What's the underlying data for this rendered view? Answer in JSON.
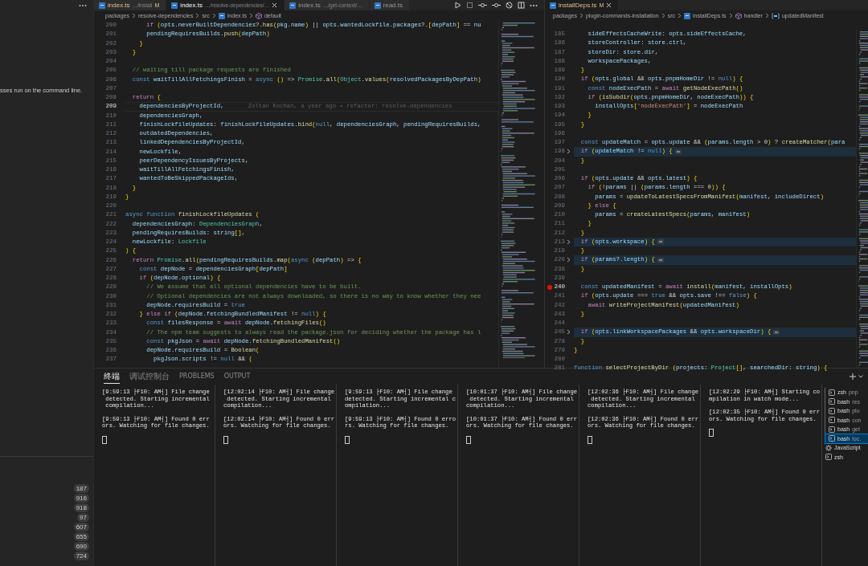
{
  "sidebar": {
    "description": "sses run on the command line.",
    "counts": [
      "187",
      "916",
      "918",
      "97",
      "607",
      "655",
      "690",
      "724"
    ]
  },
  "editor_groups": [
    {
      "tabs": [
        {
          "name": "index.ts",
          "path": "…/install",
          "badge": "M",
          "modified": true,
          "selected": false
        },
        {
          "name": "index.ts",
          "path": "…/resolve-dependencies/…",
          "modified": false,
          "selected": true
        },
        {
          "name": "index.ts",
          "path": "…/get-context/…",
          "modified": false,
          "selected": false
        },
        {
          "name": "read.ts",
          "modified": false,
          "selected": false
        }
      ],
      "breadcrumb": [
        {
          "label": "packages",
          "kind": "folder"
        },
        {
          "label": "resolve-dependencies",
          "kind": "folder"
        },
        {
          "label": "src",
          "kind": "folder"
        },
        {
          "label": "index.ts",
          "kind": "file"
        },
        {
          "label": "default",
          "kind": "module"
        }
      ],
      "lines": [
        {
          "n": "200",
          "kind": "code",
          "text": "      if (opts.neverBuiltDependencies?.has(pkg.name) || opts.wantedLockfile.packages?.[depPath] == nu"
        },
        {
          "n": "201",
          "kind": "code",
          "text": "      pendingRequiresBuilds.push(depPath)"
        },
        {
          "n": "202",
          "kind": "code",
          "text": "    }"
        },
        {
          "n": "203",
          "kind": "code",
          "text": "  }"
        },
        {
          "n": "204",
          "kind": "code"
        },
        {
          "n": "205",
          "kind": "code",
          "text": "  // waiting till package requests are finished"
        },
        {
          "n": "206",
          "kind": "code",
          "text": "  const waitTillAllFetchingsFinish = async () => Promise.all(Object.values(resolvedPackagesByDepPath)"
        },
        {
          "n": "207",
          "kind": "code"
        },
        {
          "n": "208",
          "kind": "code",
          "text": "  return {"
        },
        {
          "n": "209",
          "kind": "current",
          "text": "    dependenciesByProjectId,",
          "blame": "Zoltan Kochan, a year ago • refactor: resolve-dependencies"
        },
        {
          "n": "210",
          "kind": "code",
          "text": "    dependenciesGraph,"
        },
        {
          "n": "211",
          "kind": "code",
          "text": "    finishLockfileUpdates: finishLockfileUpdates.bind(null, dependenciesGraph, pendingRequiresBuilds,"
        },
        {
          "n": "212",
          "kind": "code",
          "text": "    outdatedDependencies,"
        },
        {
          "n": "213",
          "kind": "code",
          "text": "    linkedDependenciesByProjectId,"
        },
        {
          "n": "214",
          "kind": "code",
          "text": "    newLockfile,"
        },
        {
          "n": "215",
          "kind": "code",
          "text": "    peerDependencyIssuesByProjects,"
        },
        {
          "n": "216",
          "kind": "code",
          "text": "    waitTillAllFetchingsFinish,"
        },
        {
          "n": "217",
          "kind": "code",
          "text": "    wantedToBeSkippedPackageIds,"
        },
        {
          "n": "218",
          "kind": "code",
          "text": "  }"
        },
        {
          "n": "219",
          "kind": "code",
          "text": "}"
        },
        {
          "n": "220",
          "kind": "code"
        },
        {
          "n": "221",
          "kind": "code",
          "text": "async function finishLockfileUpdates ("
        },
        {
          "n": "222",
          "kind": "code",
          "text": "  dependenciesGraph: DependenciesGraph,"
        },
        {
          "n": "223",
          "kind": "code",
          "text": "  pendingRequiresBuilds: string[],"
        },
        {
          "n": "224",
          "kind": "code",
          "text": "  newLockfile: Lockfile"
        },
        {
          "n": "225",
          "kind": "code",
          "text": ") {"
        },
        {
          "n": "226",
          "kind": "code",
          "text": "  return Promise.all(pendingRequiresBuilds.map(async (depPath) => {"
        },
        {
          "n": "227",
          "kind": "code",
          "text": "    const depNode = dependenciesGraph[depPath]"
        },
        {
          "n": "228",
          "kind": "code",
          "text": "    if (depNode.optional) {"
        },
        {
          "n": "229",
          "kind": "code",
          "text": "      // We assume that all optional dependencies have to be built."
        },
        {
          "n": "230",
          "kind": "code",
          "text": "      // Optional dependencies are not always downloaded, so there is no way to know whether they nee"
        },
        {
          "n": "231",
          "kind": "code",
          "text": "      depNode.requiresBuild = true"
        },
        {
          "n": "232",
          "kind": "code",
          "text": "    } else if (depNode.fetchingBundledManifest != null) {"
        },
        {
          "n": "233",
          "kind": "code",
          "text": "      const filesResponse = await depNode.fetchingFiles()"
        },
        {
          "n": "234",
          "kind": "code",
          "text": "      // The npm team suggests to always read the package.json for deciding whether the package has l"
        },
        {
          "n": "235",
          "kind": "code",
          "text": "      const pkgJson = await depNode.fetchingBundledManifest()"
        },
        {
          "n": "236",
          "kind": "code",
          "text": "      depNode.requiresBuild = Boolean("
        },
        {
          "n": "237",
          "kind": "code",
          "text": "        pkgJson.scripts != null && ("
        }
      ]
    },
    {
      "tabs": [
        {
          "name": "installDeps.ts",
          "badge": "M",
          "modified": true,
          "selected": true
        }
      ],
      "breadcrumb": [
        {
          "label": "packages",
          "kind": "folder"
        },
        {
          "label": "plugin-commands-installation",
          "kind": "folder"
        },
        {
          "label": "src",
          "kind": "folder"
        },
        {
          "label": "installDeps.ts",
          "kind": "file"
        },
        {
          "label": "handler",
          "kind": "method"
        },
        {
          "label": "updatedManifest",
          "kind": "variable"
        }
      ],
      "lines": [
        {
          "n": "185",
          "kind": "code",
          "text": "    sideEffectsCacheWrite: opts.sideEffectsCache,"
        },
        {
          "n": "186",
          "kind": "code",
          "text": "    storeController: store.ctrl,"
        },
        {
          "n": "187",
          "kind": "code",
          "text": "    storeDir: store.dir,"
        },
        {
          "n": "188",
          "kind": "code",
          "text": "    workspacePackages,"
        },
        {
          "n": "189",
          "kind": "code",
          "text": "  }"
        },
        {
          "n": "190",
          "kind": "code",
          "text": "  if (opts.global && opts.pnpmHomeDir != null) {"
        },
        {
          "n": "191",
          "kind": "code",
          "text": "    const nodeExecPath = await getNodeExecPath()"
        },
        {
          "n": "192",
          "kind": "code",
          "text": "    if (isSubdir(opts.pnpmHomeDir, nodeExecPath)) {"
        },
        {
          "n": "193",
          "kind": "code",
          "text": "      installOpts['nodeExecPath'] = nodeExecPath"
        },
        {
          "n": "194",
          "kind": "code",
          "text": "    }"
        },
        {
          "n": "195",
          "kind": "code",
          "text": "  }"
        },
        {
          "n": "196",
          "kind": "code"
        },
        {
          "n": "197",
          "kind": "code",
          "text": "  const updateMatch = opts.update && (params.length > 0) ? createMatcher(para"
        },
        {
          "n": "198",
          "kind": "folded",
          "text": "  if (updateMatch != null) {"
        },
        {
          "n": "204",
          "kind": "code",
          "text": "  }"
        },
        {
          "n": "205",
          "kind": "code"
        },
        {
          "n": "206",
          "kind": "code",
          "text": "  if (opts.update && opts.latest) {"
        },
        {
          "n": "207",
          "kind": "code",
          "text": "    if (!params || (params.length === 0)) {"
        },
        {
          "n": "208",
          "kind": "code",
          "text": "      params = updateToLatestSpecsFromManifest(manifest, includeDirect)"
        },
        {
          "n": "209",
          "kind": "code",
          "text": "    } else {"
        },
        {
          "n": "210",
          "kind": "code",
          "text": "      params = createLatestSpecs(params, manifest)"
        },
        {
          "n": "211",
          "kind": "code",
          "text": "    }"
        },
        {
          "n": "212",
          "kind": "code",
          "text": "  }"
        },
        {
          "n": "213",
          "kind": "folded",
          "text": "  if (opts.workspace) {"
        },
        {
          "n": "219",
          "kind": "code",
          "text": "  }"
        },
        {
          "n": "220",
          "kind": "folded",
          "text": "  if (params?.length) {"
        },
        {
          "n": "238",
          "kind": "code",
          "text": "  }"
        },
        {
          "n": "239",
          "kind": "code"
        },
        {
          "n": "240",
          "kind": "breakpoint",
          "text": "  const updatedManifest = await install(manifest, installOpts)"
        },
        {
          "n": "241",
          "kind": "code",
          "text": "  if (opts.update === true && opts.save !== false) {"
        },
        {
          "n": "242",
          "kind": "code",
          "text": "    await writeProjectManifest(updatedManifest)"
        },
        {
          "n": "243",
          "kind": "code",
          "text": "  }"
        },
        {
          "n": "244",
          "kind": "code"
        },
        {
          "n": "245",
          "kind": "folded",
          "text": "  if (opts.linkWorkspacePackages && opts.workspaceDir) {"
        },
        {
          "n": "278",
          "kind": "code",
          "text": "  }"
        },
        {
          "n": "279",
          "kind": "code",
          "text": "}"
        },
        {
          "n": "280",
          "kind": "code"
        },
        {
          "n": "281",
          "kind": "code",
          "text": "function selectProjectByDir (projects: Project[], searchedDir: string) {"
        }
      ]
    }
  ],
  "panel": {
    "tabs": [
      {
        "label": "终端",
        "selected": true
      },
      {
        "label": "调试控制台",
        "selected": false
      },
      {
        "label": "PROBLEMS",
        "selected": false
      },
      {
        "label": "OUTPUT",
        "selected": false
      }
    ],
    "terminals": [
      {
        "entries": [
          [
            "[9:59:13 ├F10: AM┤] File change",
            " detected. Starting incremental",
            " compilation..."
          ],
          [
            "[9:59:13 ├F10: AM┤] Found 0 err",
            "ors. Watching for file changes."
          ]
        ]
      },
      {
        "entries": [
          [
            "[12:02:14 ├F10: AM┤] File change",
            " detected. Starting incremental",
            "compilation..."
          ],
          [
            "[12:02:14 ├F10: AM┤] Found 0 err",
            "ors. Watching for file changes."
          ]
        ]
      },
      {
        "entries": [
          [
            "[9:59:13 ├F10: AM┤] File change",
            "detected. Starting incremental c",
            "ompilation..."
          ],
          [
            "[9:59:13 ├F10: AM┤] Found 0 erro",
            "rs. Watching for file changes."
          ]
        ]
      },
      {
        "entries": [
          [
            "[10:01:37 ├F10: AM┤] File change",
            " detected. Starting incremental",
            "compilation..."
          ],
          [
            "[10:01:37 ├F10: AM┤] Found 0 err",
            "ors. Watching for file changes."
          ]
        ]
      },
      {
        "entries": [
          [
            "[12:02:36 ├F10: AM┤] File change",
            " detected. Starting incremental",
            "compilation..."
          ],
          [
            "[12:02:36 ├F10: AM┤] Found 0 err",
            "ors. Watching for file changes."
          ]
        ]
      },
      {
        "entries": [
          [
            "[12:02:29 ├F10: AM┤] Starting co",
            "mpilation in watch mode..."
          ],
          [
            "[12:02:35 ├F10: AM┤] Found 0 err",
            "ors. Watching for file changes."
          ]
        ]
      }
    ],
    "terminal_list": [
      {
        "kind": "group",
        "children": [
          {
            "kind": "terminal",
            "shell": "zsh",
            "detail": "pnp",
            "selected": false
          },
          {
            "kind": "terminal",
            "shell": "bash",
            "detail": "res",
            "selected": false
          },
          {
            "kind": "terminal",
            "shell": "bash",
            "detail": "plu",
            "selected": false
          },
          {
            "kind": "terminal",
            "shell": "bash",
            "detail": "con",
            "selected": false
          },
          {
            "kind": "terminal",
            "shell": "bash",
            "detail": "get",
            "selected": false
          },
          {
            "kind": "terminal",
            "shell": "bash",
            "detail": "loc.",
            "selected": true
          }
        ]
      },
      {
        "kind": "debug",
        "shell": "JavaScript",
        "selected": false
      },
      {
        "kind": "terminal",
        "shell": "zsh",
        "selected": false
      }
    ]
  }
}
